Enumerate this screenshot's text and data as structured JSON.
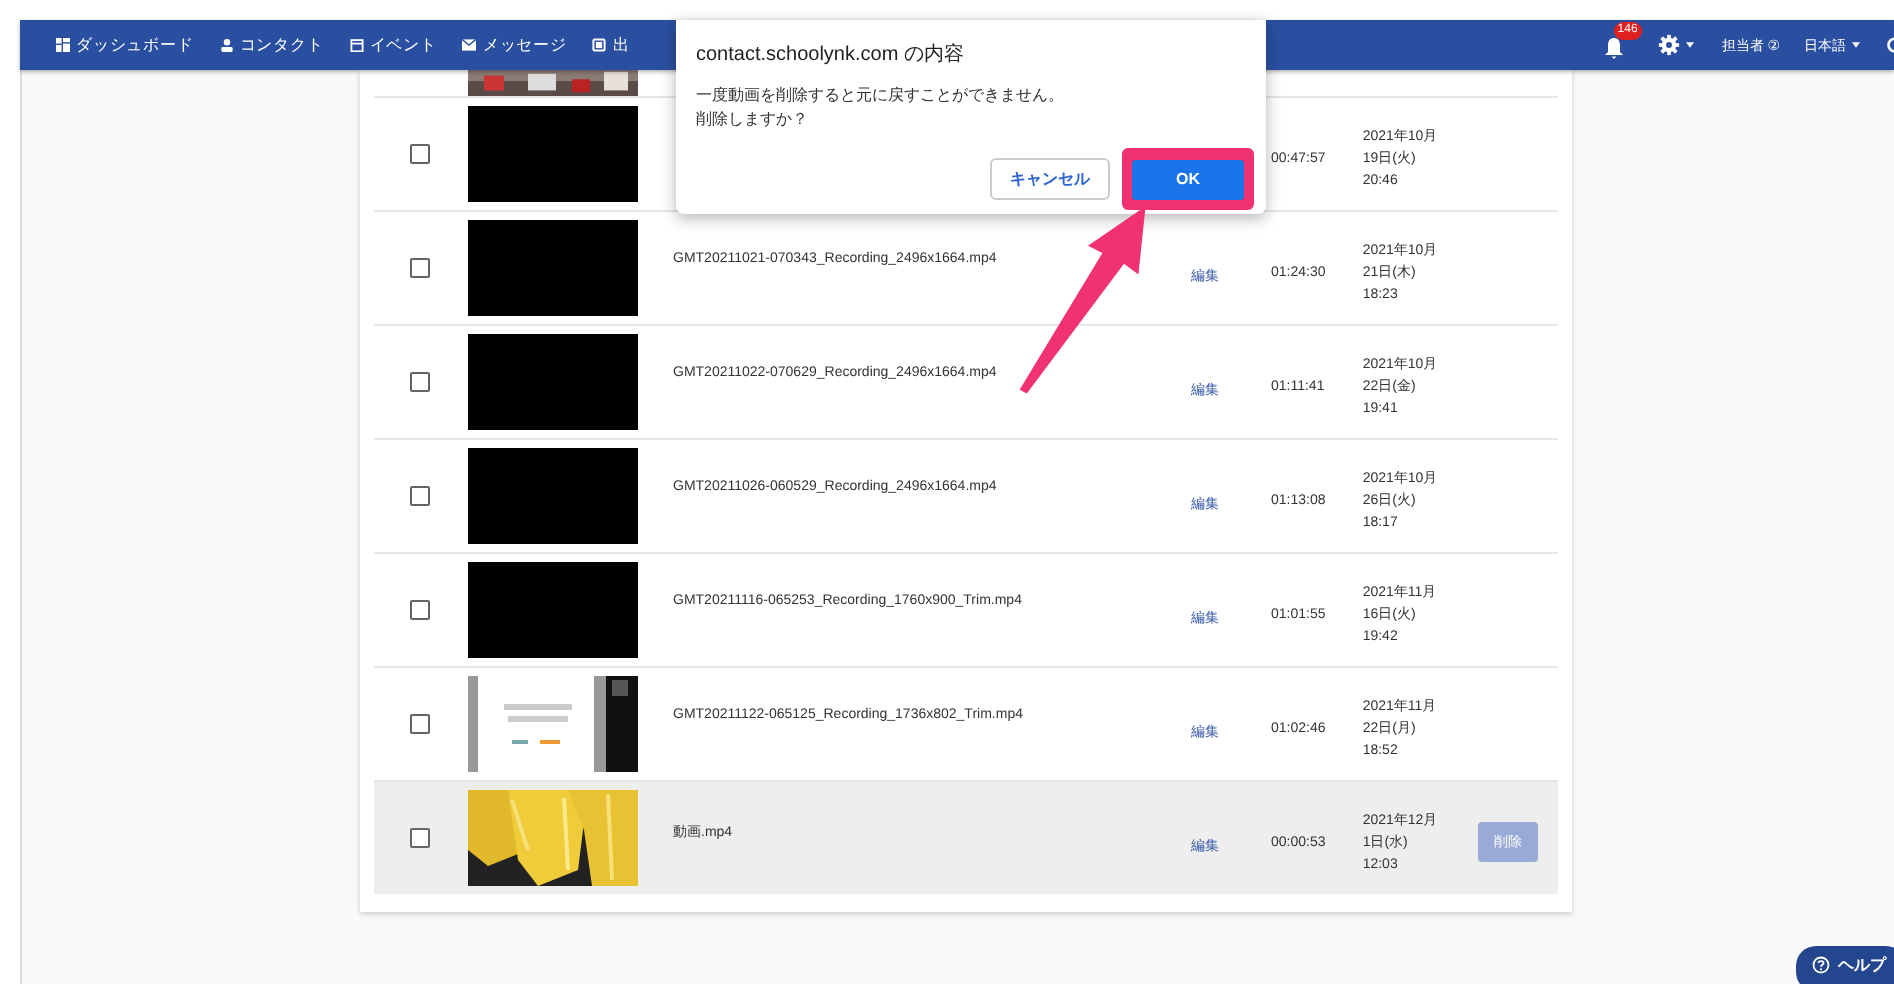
{
  "nav": {
    "items": [
      {
        "kind": "dashboard",
        "label": "ダッシュボード"
      },
      {
        "kind": "person",
        "label": "コンタクト"
      },
      {
        "kind": "calendar",
        "label": "イベント"
      },
      {
        "kind": "mail",
        "label": "メッセージ"
      },
      {
        "kind": "square",
        "label": "出"
      }
    ],
    "notification_count": "146",
    "user": "担当者 ②",
    "language": "日本語"
  },
  "dialog": {
    "title": "contact.schoolynk.com の内容",
    "message": [
      "一度動画を削除すると元に戻すことができません。",
      "削除しますか？"
    ],
    "cancel": "キャンセル",
    "ok": "OK",
    "ok_highlighted": true
  },
  "rows": [
    {
      "kind": "blank",
      "duration": "00:47:57",
      "date": [
        "2021年10月",
        "19日(火)",
        "20:46"
      ],
      "checked": false,
      "selected": false
    },
    {
      "kind": "blank",
      "name": "GMT20211021-070343_Recording_2496x1664.mp4",
      "edit": "編集",
      "duration": "01:24:30",
      "date": [
        "2021年10月",
        "21日(木)",
        "18:23"
      ],
      "checked": false,
      "selected": false
    },
    {
      "kind": "blank",
      "name": "GMT20211022-070629_Recording_2496x1664.mp4",
      "edit": "編集",
      "duration": "01:11:41",
      "date": [
        "2021年10月",
        "22日(金)",
        "19:41"
      ],
      "checked": false,
      "selected": false
    },
    {
      "kind": "blank",
      "name": "GMT20211026-060529_Recording_2496x1664.mp4",
      "edit": "編集",
      "duration": "01:13:08",
      "date": [
        "2021年10月",
        "26日(火)",
        "18:17"
      ],
      "checked": false,
      "selected": false
    },
    {
      "kind": "blank",
      "name": "GMT20211116-065253_Recording_1760x900_Trim.mp4",
      "edit": "編集",
      "duration": "01:01:55",
      "date": [
        "2021年11月",
        "16日(火)",
        "19:42"
      ],
      "checked": false,
      "selected": false
    },
    {
      "kind": "picture",
      "name": "GMT20211122-065125_Recording_1736x802_Trim.mp4",
      "edit": "編集",
      "duration": "01:02:46",
      "date": [
        "2021年11月",
        "22日(月)",
        "18:52"
      ],
      "checked": false,
      "selected": false
    },
    {
      "kind": "picture",
      "name": "動画.mp4",
      "edit": "編集",
      "duration": "00:00:53",
      "date": [
        "2021年12月",
        "1日(水)",
        "12:03"
      ],
      "checked": false,
      "selected": true,
      "delete": "削除"
    }
  ],
  "help": "ヘルプ"
}
